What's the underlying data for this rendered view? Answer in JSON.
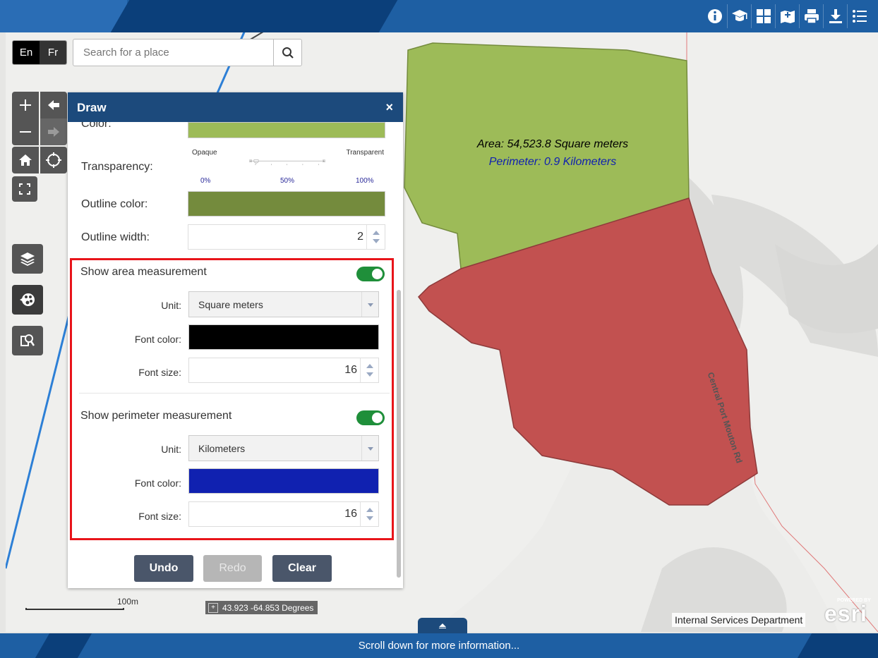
{
  "header": {
    "tools": [
      "info-icon",
      "graduation-cap-icon",
      "grid-icon",
      "add-map-icon",
      "print-icon",
      "download-icon",
      "list-icon"
    ]
  },
  "language": {
    "en": "En",
    "fr": "Fr"
  },
  "search": {
    "placeholder": "Search for a place"
  },
  "map": {
    "area_label": "Area: 54,523.8 Square meters",
    "perimeter_label": "Perimeter: 0.9 Kilometers",
    "road_label": "Central Port Mouton Rd",
    "colors": {
      "green_polygon": "#9dbb58",
      "red_polygon": "#c25150",
      "perimeter_text": "#1a2db4"
    }
  },
  "draw_panel": {
    "title": "Draw",
    "close": "×",
    "color_label": "Color:",
    "color_value": "#9dbb58",
    "transparency_label": "Transparency:",
    "transparency": {
      "left": "Opaque",
      "right": "Transparent",
      "ticks": [
        "0%",
        "50%",
        "100%"
      ],
      "value_fraction": 0.06
    },
    "outline_color_label": "Outline color:",
    "outline_color_value": "#748b3d",
    "outline_width_label": "Outline width:",
    "outline_width": "2",
    "area_section": {
      "label": "Show area measurement",
      "enabled": true,
      "unit_label": "Unit:",
      "unit": "Square meters",
      "font_color_label": "Font color:",
      "font_color": "#000000",
      "font_size_label": "Font size:",
      "font_size": "16"
    },
    "perimeter_section": {
      "label": "Show perimeter measurement",
      "enabled": true,
      "unit_label": "Unit:",
      "unit": "Kilometers",
      "font_color_label": "Font color:",
      "font_color": "#1021b0",
      "font_size_label": "Font size:",
      "font_size": "16"
    },
    "buttons": {
      "undo": "Undo",
      "redo": "Redo",
      "clear": "Clear"
    }
  },
  "footer": {
    "scale": "100m",
    "coordinates": "43.923 -64.853 Degrees",
    "attribution": "Internal Services Department",
    "esri_powered": "POWERED BY",
    "esri": "esri",
    "scroll_hint": "Scroll down for more information..."
  }
}
